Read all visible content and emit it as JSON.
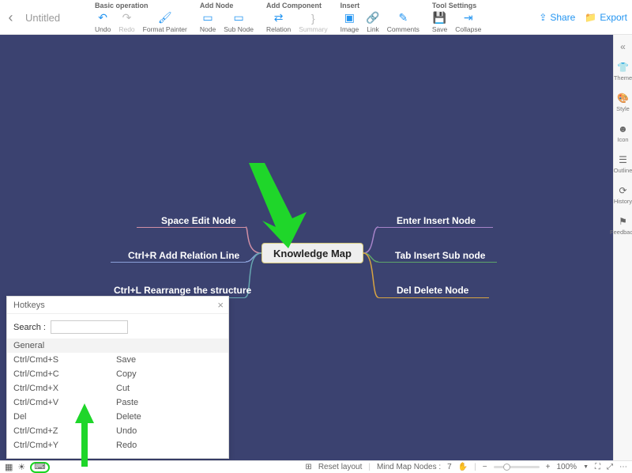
{
  "title": "Untitled",
  "toolbar": {
    "groups": [
      {
        "label": "Basic operation",
        "items": [
          {
            "name": "undo",
            "label": "Undo",
            "icon": "↶",
            "dis": false
          },
          {
            "name": "redo",
            "label": "Redo",
            "icon": "↷",
            "dis": true
          },
          {
            "name": "format-painter",
            "label": "Format Painter",
            "icon": "🖌",
            "dis": false
          }
        ]
      },
      {
        "label": "Add Node",
        "items": [
          {
            "name": "node",
            "label": "Node",
            "icon": "▭",
            "dis": false
          },
          {
            "name": "sub-node",
            "label": "Sub Node",
            "icon": "▭",
            "dis": false
          }
        ]
      },
      {
        "label": "Add Component",
        "items": [
          {
            "name": "relation",
            "label": "Relation",
            "icon": "⇄",
            "dis": false
          },
          {
            "name": "summary",
            "label": "Summary",
            "icon": "}",
            "dis": true
          }
        ]
      },
      {
        "label": "Insert",
        "items": [
          {
            "name": "image",
            "label": "Image",
            "icon": "▣",
            "dis": false
          },
          {
            "name": "link",
            "label": "Link",
            "icon": "🔗",
            "dis": false
          },
          {
            "name": "comments",
            "label": "Comments",
            "icon": "✎",
            "dis": false
          }
        ]
      },
      {
        "label": "Tool Settings",
        "items": [
          {
            "name": "save",
            "label": "Save",
            "icon": "💾",
            "dis": false
          },
          {
            "name": "collapse",
            "label": "Collapse",
            "icon": "⇥",
            "dis": false
          }
        ]
      }
    ],
    "share": "Share",
    "export": "Export"
  },
  "sidebar": [
    {
      "name": "theme",
      "label": "Theme",
      "icon": "👕"
    },
    {
      "name": "style",
      "label": "Style",
      "icon": "🎨"
    },
    {
      "name": "icon",
      "label": "Icon",
      "icon": "☻"
    },
    {
      "name": "outline",
      "label": "Outline",
      "icon": "☰"
    },
    {
      "name": "history",
      "label": "History",
      "icon": "⟳"
    },
    {
      "name": "feedback",
      "label": "Feedback",
      "icon": "⚑"
    }
  ],
  "center": "Knowledge Map",
  "branches": {
    "l": [
      "Space Edit Node",
      "Ctrl+R Add Relation Line",
      "Ctrl+L Rearrange the structure"
    ],
    "r": [
      "Enter Insert Node",
      "Tab Insert Sub node",
      "Del Delete Node"
    ]
  },
  "hotkeys": {
    "title": "Hotkeys",
    "searchLabel": "Search :",
    "section": "General",
    "rows": [
      {
        "k": "Ctrl/Cmd+S",
        "v": "Save"
      },
      {
        "k": "Ctrl/Cmd+C",
        "v": "Copy"
      },
      {
        "k": "Ctrl/Cmd+X",
        "v": "Cut"
      },
      {
        "k": "Ctrl/Cmd+V",
        "v": "Paste"
      },
      {
        "k": "Del",
        "v": "Delete"
      },
      {
        "k": "Ctrl/Cmd+Z",
        "v": "Undo"
      },
      {
        "k": "Ctrl/Cmd+Y",
        "v": "Redo"
      }
    ]
  },
  "status": {
    "resetLayout": "Reset layout",
    "nodesLabel": "Mind Map Nodes :",
    "nodesCount": "7",
    "zoom": "100%"
  }
}
